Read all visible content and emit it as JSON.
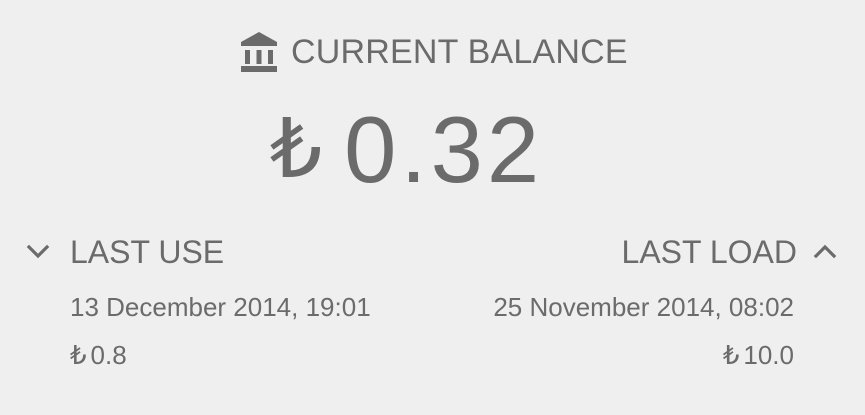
{
  "balance": {
    "icon": "bank-icon",
    "title": "CURRENT BALANCE",
    "currency_symbol": "₺",
    "amount": "0.32"
  },
  "last_use": {
    "icon": "chevron-down-icon",
    "label": "LAST USE",
    "date": "13 December 2014, 19:01",
    "currency_symbol": "₺",
    "amount": "0.8"
  },
  "last_load": {
    "icon": "chevron-up-icon",
    "label": "LAST LOAD",
    "date": "25 November 2014, 08:02",
    "currency_symbol": "₺",
    "amount": "10.0"
  },
  "colors": {
    "background": "#efefef",
    "text": "#6b6b6b"
  }
}
